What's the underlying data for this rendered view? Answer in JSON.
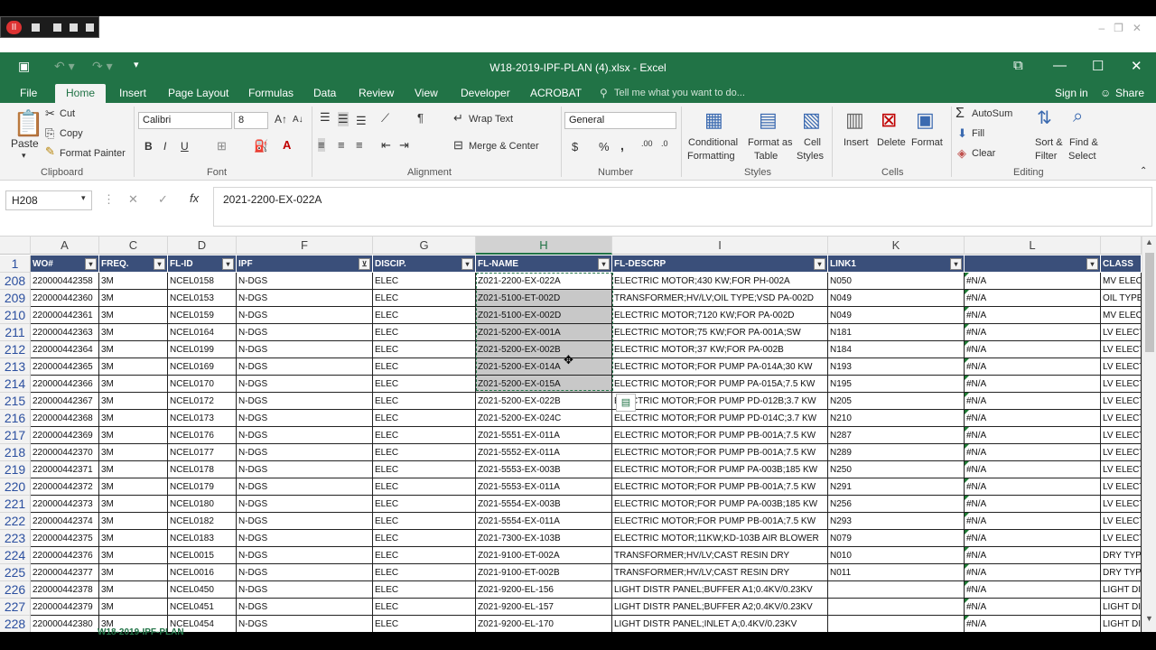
{
  "window": {
    "title": "W18-2019-IPF-PLAN (4).xlsx - Excel",
    "controls": [
      "⧉",
      "—",
      "☐",
      "✕"
    ]
  },
  "menu_tabs": [
    "File",
    "Home",
    "Insert",
    "Page Layout",
    "Formulas",
    "Data",
    "Review",
    "View",
    "Developer",
    "ACROBAT"
  ],
  "tell_me": "Tell me what you want to do...",
  "sign_in": "Sign in",
  "share": "Share",
  "ribbon": {
    "clipboard": {
      "paste": "Paste",
      "cut": "Cut",
      "copy": "Copy",
      "format_painter": "Format Painter",
      "label": "Clipboard"
    },
    "font": {
      "name": "Calibri",
      "size": "8",
      "label": "Font",
      "bold": "B",
      "italic": "I",
      "underline": "U"
    },
    "alignment": {
      "wrap": "Wrap Text",
      "merge": "Merge & Center",
      "label": "Alignment"
    },
    "number": {
      "format": "General",
      "currency": "$",
      "percent": "%",
      "comma": ",",
      "label": "Number"
    },
    "styles": {
      "conditional": "Conditional",
      "formatting": "Formatting",
      "format_as": "Format as",
      "table": "Table",
      "cell": "Cell",
      "cell_styles": "Styles",
      "label": "Styles"
    },
    "cells": {
      "insert": "Insert",
      "delete": "Delete",
      "format": "Format",
      "label": "Cells"
    },
    "editing": {
      "autosum": "AutoSum",
      "fill": "Fill",
      "clear": "Clear",
      "sort": "Sort &",
      "filter": "Filter",
      "find": "Find &",
      "select": "Select",
      "label": "Editing"
    }
  },
  "name_box": "H208",
  "formula": "2021-2200-EX-022A",
  "columns": [
    "A",
    "C",
    "D",
    "F",
    "G",
    "H",
    "I",
    "K",
    "L"
  ],
  "header_row_number": "1",
  "headers": [
    "WO#",
    "FREQ.",
    "FL-ID",
    "IPF",
    "DISCIP.",
    "FL-NAME",
    "FL-DESCRP",
    "LINK1",
    "",
    "CLASS"
  ],
  "rows": [
    {
      "n": "208",
      "c": [
        "220000442358",
        "3M",
        "NCEL0158",
        "N-DGS",
        "ELEC",
        "Z021-2200-EX-022A",
        "ELECTRIC MOTOR;430 KW;FOR PH-002A",
        "N050",
        "#N/A",
        "MV ELECT"
      ]
    },
    {
      "n": "209",
      "c": [
        "220000442360",
        "3M",
        "NCEL0153",
        "N-DGS",
        "ELEC",
        "Z021-5100-ET-002D",
        "TRANSFORMER;HV/LV;OIL TYPE;VSD PA-002D",
        "N049",
        "#N/A",
        "OIL TYPE"
      ]
    },
    {
      "n": "210",
      "c": [
        "220000442361",
        "3M",
        "NCEL0159",
        "N-DGS",
        "ELEC",
        "Z021-5100-EX-002D",
        "ELECTRIC MOTOR;7120 KW;FOR PA-002D",
        "N049",
        "#N/A",
        "MV ELECT"
      ]
    },
    {
      "n": "211",
      "c": [
        "220000442363",
        "3M",
        "NCEL0164",
        "N-DGS",
        "ELEC",
        "Z021-5200-EX-001A",
        "ELECTRIC MOTOR;75 KW;FOR PA-001A;SW",
        "N181",
        "#N/A",
        "LV ELECT"
      ]
    },
    {
      "n": "212",
      "c": [
        "220000442364",
        "3M",
        "NCEL0199",
        "N-DGS",
        "ELEC",
        "Z021-5200-EX-002B",
        "ELECTRIC MOTOR;37 KW;FOR PA-002B",
        "N184",
        "#N/A",
        "LV ELECT"
      ]
    },
    {
      "n": "213",
      "c": [
        "220000442365",
        "3M",
        "NCEL0169",
        "N-DGS",
        "ELEC",
        "Z021-5200-EX-014A",
        "ELECTRIC MOTOR;FOR PUMP PA-014A;30 KW",
        "N193",
        "#N/A",
        "LV ELECT"
      ]
    },
    {
      "n": "214",
      "c": [
        "220000442366",
        "3M",
        "NCEL0170",
        "N-DGS",
        "ELEC",
        "Z021-5200-EX-015A",
        "ELECTRIC MOTOR;FOR PUMP PA-015A;7.5 KW",
        "N195",
        "#N/A",
        "LV ELECT"
      ]
    },
    {
      "n": "215",
      "c": [
        "220000442367",
        "3M",
        "NCEL0172",
        "N-DGS",
        "ELEC",
        "Z021-5200-EX-022B",
        "ELECTRIC MOTOR;FOR PUMP PD-012B;3.7 KW",
        "N205",
        "#N/A",
        "LV ELECT"
      ]
    },
    {
      "n": "216",
      "c": [
        "220000442368",
        "3M",
        "NCEL0173",
        "N-DGS",
        "ELEC",
        "Z021-5200-EX-024C",
        "ELECTRIC MOTOR;FOR PUMP PD-014C;3.7 KW",
        "N210",
        "#N/A",
        "LV ELECT"
      ]
    },
    {
      "n": "217",
      "c": [
        "220000442369",
        "3M",
        "NCEL0176",
        "N-DGS",
        "ELEC",
        "Z021-5551-EX-011A",
        "ELECTRIC MOTOR;FOR PUMP PB-001A;7.5 KW",
        "N287",
        "#N/A",
        "LV ELECT"
      ]
    },
    {
      "n": "218",
      "c": [
        "220000442370",
        "3M",
        "NCEL0177",
        "N-DGS",
        "ELEC",
        "Z021-5552-EX-011A",
        "ELECTRIC MOTOR;FOR PUMP PB-001A;7.5 KW",
        "N289",
        "#N/A",
        "LV ELECT"
      ]
    },
    {
      "n": "219",
      "c": [
        "220000442371",
        "3M",
        "NCEL0178",
        "N-DGS",
        "ELEC",
        "Z021-5553-EX-003B",
        "ELECTRIC MOTOR;FOR PUMP PA-003B;185 KW",
        "N250",
        "#N/A",
        "LV ELECT"
      ]
    },
    {
      "n": "220",
      "c": [
        "220000442372",
        "3M",
        "NCEL0179",
        "N-DGS",
        "ELEC",
        "Z021-5553-EX-011A",
        "ELECTRIC MOTOR;FOR PUMP PB-001A;7.5 KW",
        "N291",
        "#N/A",
        "LV ELECT"
      ]
    },
    {
      "n": "221",
      "c": [
        "220000442373",
        "3M",
        "NCEL0180",
        "N-DGS",
        "ELEC",
        "Z021-5554-EX-003B",
        "ELECTRIC MOTOR;FOR PUMP PA-003B;185 KW",
        "N256",
        "#N/A",
        "LV ELECT"
      ]
    },
    {
      "n": "222",
      "c": [
        "220000442374",
        "3M",
        "NCEL0182",
        "N-DGS",
        "ELEC",
        "Z021-5554-EX-011A",
        "ELECTRIC MOTOR;FOR PUMP PB-001A;7.5 KW",
        "N293",
        "#N/A",
        "LV ELECT"
      ]
    },
    {
      "n": "223",
      "c": [
        "220000442375",
        "3M",
        "NCEL0183",
        "N-DGS",
        "ELEC",
        "Z021-7300-EX-103B",
        "ELECTRIC MOTOR;11KW;KD-103B AIR BLOWER",
        "N079",
        "#N/A",
        "LV ELECT"
      ]
    },
    {
      "n": "224",
      "c": [
        "220000442376",
        "3M",
        "NCEL0015",
        "N-DGS",
        "ELEC",
        "Z021-9100-ET-002A",
        "TRANSFORMER;HV/LV;CAST RESIN DRY",
        "N010",
        "#N/A",
        "DRY TYPE"
      ]
    },
    {
      "n": "225",
      "c": [
        "220000442377",
        "3M",
        "NCEL0016",
        "N-DGS",
        "ELEC",
        "Z021-9100-ET-002B",
        "TRANSFORMER;HV/LV;CAST RESIN DRY",
        "N011",
        "#N/A",
        "DRY TYPE"
      ]
    },
    {
      "n": "226",
      "c": [
        "220000442378",
        "3M",
        "NCEL0450",
        "N-DGS",
        "ELEC",
        "Z021-9200-EL-156",
        "LIGHT DISTR PANEL;BUFFER A1;0.4KV/0.23KV",
        "",
        "#N/A",
        "LIGHT DI"
      ]
    },
    {
      "n": "227",
      "c": [
        "220000442379",
        "3M",
        "NCEL0451",
        "N-DGS",
        "ELEC",
        "Z021-9200-EL-157",
        "LIGHT DISTR PANEL;BUFFER A2;0.4KV/0.23KV",
        "",
        "#N/A",
        "LIGHT DI"
      ]
    },
    {
      "n": "228",
      "c": [
        "220000442380",
        "3M",
        "NCEL0454",
        "N-DGS",
        "ELEC",
        "Z021-9200-EL-170",
        "LIGHT DISTR PANEL;INLET A;0.4KV/0.23KV",
        "",
        "#N/A",
        "LIGHT DI"
      ]
    }
  ],
  "sheet_tab": "W18-2019-IPF-PLAN",
  "colors": {
    "excel_green": "#217346",
    "header_fill": "#3a4f7a",
    "selection_fill": "#c8c8c8"
  }
}
